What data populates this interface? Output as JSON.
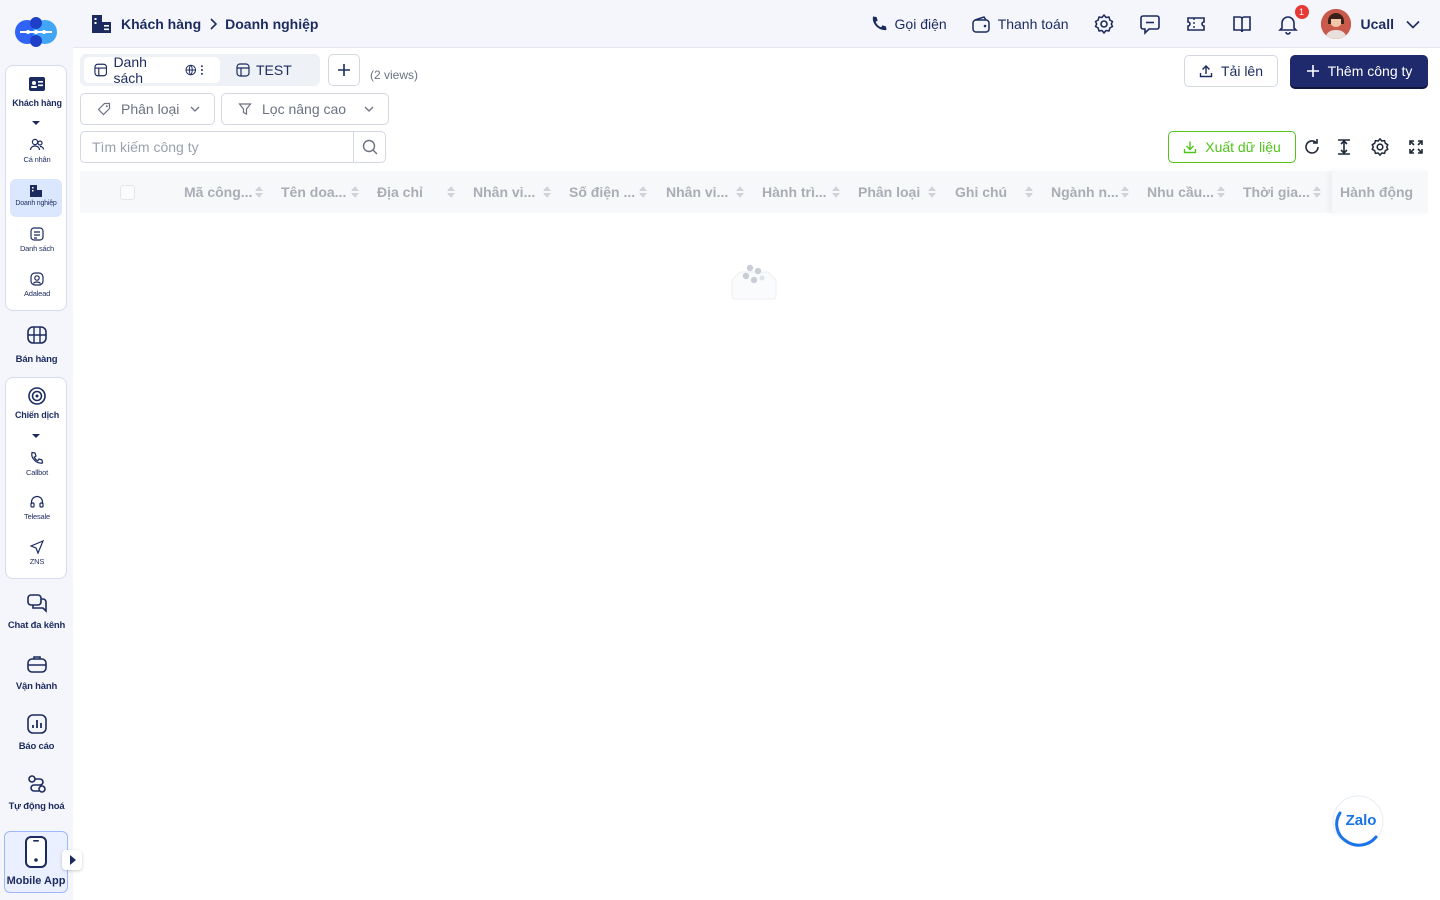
{
  "sidebar": {
    "group1": {
      "header": {
        "label": "Khách hàng",
        "icon": "contact-card-icon"
      },
      "items": [
        {
          "label": "Cá nhân",
          "icon": "users-icon"
        },
        {
          "label": "Doanh nghiệp",
          "icon": "building-icon",
          "active": true
        },
        {
          "label": "Danh sách",
          "icon": "list-icon"
        },
        {
          "label": "Adalead",
          "icon": "user-circle-icon"
        }
      ]
    },
    "sales": {
      "label": "Bán hàng",
      "icon": "store-icon"
    },
    "group2": {
      "header": {
        "label": "Chiến dịch",
        "icon": "target-icon"
      },
      "items": [
        {
          "label": "Callbot",
          "icon": "phone-icon"
        },
        {
          "label": "Telesale",
          "icon": "headset-icon"
        },
        {
          "label": "ZNS",
          "icon": "send-icon"
        }
      ]
    },
    "others": [
      {
        "label": "Chat đa kênh",
        "icon": "chat-icon"
      },
      {
        "label": "Vận hành",
        "icon": "briefcase-icon"
      },
      {
        "label": "Báo cáo",
        "icon": "chart-icon"
      },
      {
        "label": "Tự động hoá",
        "icon": "automation-icon"
      }
    ],
    "mobile": {
      "label": "Mobile App",
      "icon": "mobile-icon"
    }
  },
  "topbar": {
    "breadcrumb": {
      "root": "Khách hàng",
      "current": "Doanh nghiệp"
    },
    "call_label": "Gọi điện",
    "pay_label": "Thanh toán",
    "notification_count": "1",
    "user_name": "Ucall"
  },
  "views": {
    "tabs": [
      {
        "label": "Danh sách"
      },
      {
        "label": "TEST"
      }
    ],
    "count_label": "(2 views)"
  },
  "actions": {
    "upload_label": "Tải lên",
    "add_label": "Thêm công ty",
    "export_label": "Xuất dữ liệu"
  },
  "filters": {
    "category_label": "Phân loại",
    "advanced_label": "Lọc nâng cao"
  },
  "search": {
    "placeholder": "Tìm kiếm công ty"
  },
  "table": {
    "columns": [
      "Mã công...",
      "Tên doa...",
      "Địa chỉ",
      "Nhân vi...",
      "Số điện ...",
      "Nhân vi...",
      "Hành trì...",
      "Phân loại",
      "Ghi chú",
      "Ngành n...",
      "Nhu cầu...",
      "Thời gia...",
      "Hành động"
    ]
  },
  "colors": {
    "primary": "#1e2a6b",
    "export": "#52c41a",
    "badge": "#e53935",
    "active_nav": "#dbe7ff"
  },
  "widget": {
    "label": "Zalo"
  }
}
